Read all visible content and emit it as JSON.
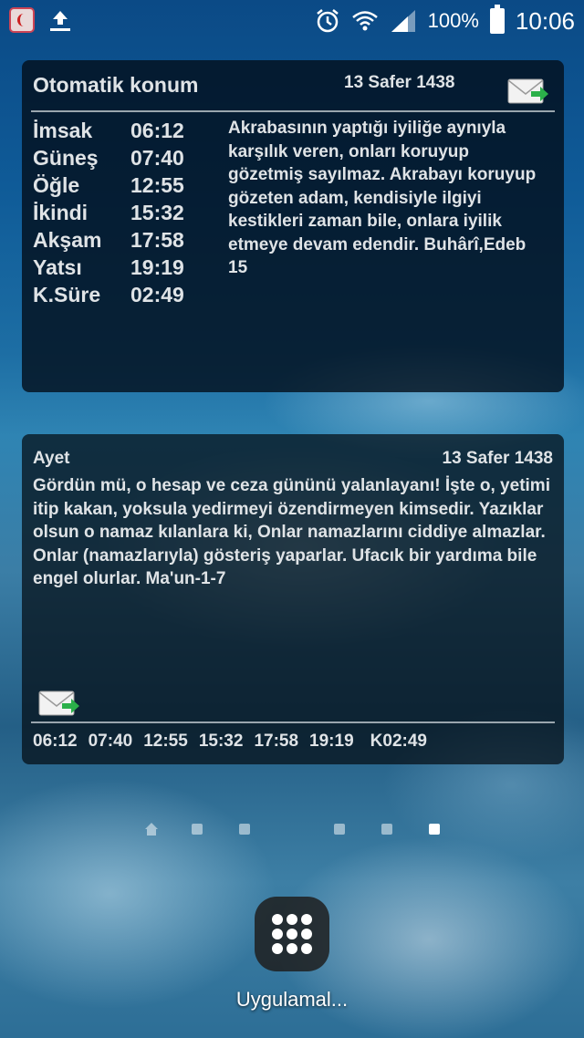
{
  "status_bar": {
    "battery": "100%",
    "time": "10:06"
  },
  "widget_prayer": {
    "title": "Otomatik konum",
    "date": "13 Safer 1438",
    "times": [
      {
        "name": "İmsak",
        "time": "06:12"
      },
      {
        "name": "Güneş",
        "time": "07:40"
      },
      {
        "name": "Öğle",
        "time": "12:55"
      },
      {
        "name": "İkindi",
        "time": "15:32"
      },
      {
        "name": "Akşam",
        "time": "17:58"
      },
      {
        "name": "Yatsı",
        "time": "19:19"
      },
      {
        "name": "K.Süre",
        "time": "02:49"
      }
    ],
    "hadith": "Akrabasının yaptığı iyiliğe aynıyla karşılık veren, onları koruyup gözetmiş sayılmaz. Akrabayı koruyup gözeten adam, kendisiyle ilgiyi kestikleri zaman bile, onlara iyilik etmeye devam edendir. Buhârî,Edeb 15"
  },
  "widget_ayet": {
    "title": "Ayet",
    "date": "13 Safer 1438",
    "text": "Gördün mü, o hesap ve ceza gününü yalanlayanı! İşte o, yetimi itip kakan, yoksula yedirmeyi özendirmeyen kimsedir. Yazıklar olsun o namaz kılanlara ki, Onlar namazlarını ciddiye almazlar. Onlar (namazlarıyla) gösteriş yaparlar. Ufacık bir yardıma bile engel olurlar. Ma'un-1-7",
    "times": [
      "06:12",
      "07:40",
      "12:55",
      "15:32",
      "17:58",
      "19:19",
      "K02:49"
    ]
  },
  "pager": {
    "pages": 6,
    "active_index": 5
  },
  "apps_button": {
    "label": "Uygulamal..."
  },
  "icons": {
    "status_left": [
      "app-notification-icon",
      "upload-icon"
    ],
    "status_right": [
      "alarm-icon",
      "wifi-icon",
      "signal-icon",
      "battery-icon"
    ],
    "widgets": [
      "mail-share-icon"
    ],
    "pager": [
      "home-page-icon"
    ],
    "apps": "apps-grid-icon"
  },
  "colors": {
    "widget_text": "#dfe3e6",
    "separator": "#9aa6ae",
    "mail_arrow": "#2bb04a"
  }
}
